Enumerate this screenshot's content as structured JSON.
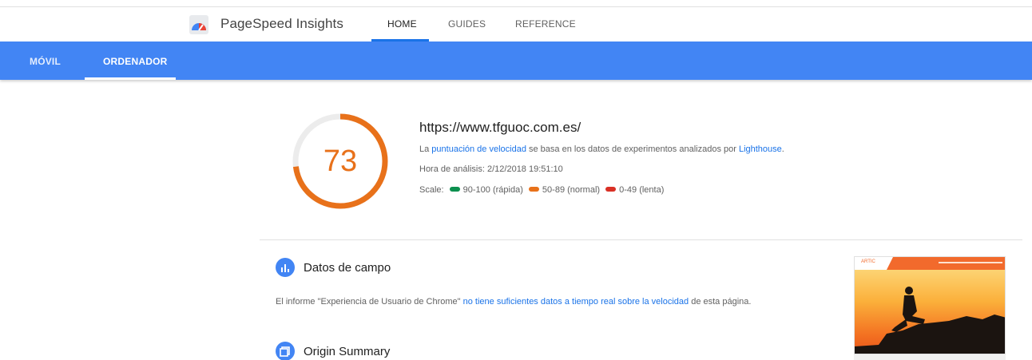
{
  "header": {
    "title": "PageSpeed Insights",
    "tabs": [
      {
        "label": "HOME"
      },
      {
        "label": "GUIDES"
      },
      {
        "label": "REFERENCE"
      }
    ]
  },
  "device_tabs": [
    {
      "label": "MÓVIL"
    },
    {
      "label": "ORDENADOR"
    }
  ],
  "score": {
    "value": "73",
    "fraction": 0.73,
    "color": "#e8711a"
  },
  "summary": {
    "url": "https://www.tfguoc.com.es/",
    "desc_prefix": "La ",
    "desc_link1": "puntuación de velocidad",
    "desc_middle": " se basa en los datos de experimentos analizados por ",
    "desc_link2": "Lighthouse",
    "desc_suffix": ".",
    "analysis_time": "Hora de análisis: 2/12/2018 19:51:10",
    "scale_label": "Scale:",
    "scale": [
      {
        "label": "90-100 (rápida)",
        "color": "#0d904f"
      },
      {
        "label": "50-89 (normal)",
        "color": "#e8711a"
      },
      {
        "label": "0-49 (lenta)",
        "color": "#d93025"
      }
    ]
  },
  "field_data": {
    "title": "Datos de campo",
    "text_prefix": "El informe \"Experiencia de Usuario de Chrome\" ",
    "text_link": "no tiene suficientes datos a tiempo real sobre la velocidad",
    "text_suffix": " de esta página.",
    "icon": "bar-chart-icon"
  },
  "origin_summary": {
    "title": "Origin Summary",
    "icon": "origin-icon"
  },
  "thumbnail": {
    "site_logo": "ARTIC",
    "icon": "website-screenshot"
  },
  "colors": {
    "accent": "#4285f4",
    "link": "#1a73e8"
  }
}
